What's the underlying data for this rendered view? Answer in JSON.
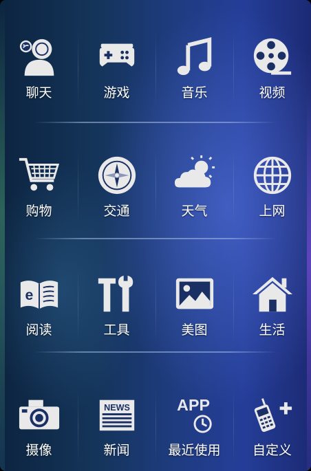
{
  "colors": {
    "icon": "#e9e9e9",
    "label": "#ffffff",
    "background_dark": "#0c2440",
    "background_light": "#243e98"
  },
  "rows": [
    {
      "items": [
        {
          "label": "聊天",
          "icon": "chat-person-icon"
        },
        {
          "label": "游戏",
          "icon": "gamepad-icon"
        },
        {
          "label": "音乐",
          "icon": "music-note-icon"
        },
        {
          "label": "视频",
          "icon": "film-reel-icon"
        }
      ]
    },
    {
      "items": [
        {
          "label": "购物",
          "icon": "shopping-cart-icon"
        },
        {
          "label": "交通",
          "icon": "compass-icon"
        },
        {
          "label": "天气",
          "icon": "weather-sun-cloud-icon"
        },
        {
          "label": "上网",
          "icon": "globe-icon"
        }
      ]
    },
    {
      "items": [
        {
          "label": "阅读",
          "icon": "open-book-icon"
        },
        {
          "label": "工具",
          "icon": "tools-icon"
        },
        {
          "label": "美图",
          "icon": "picture-icon"
        },
        {
          "label": "生活",
          "icon": "house-icon"
        }
      ]
    },
    {
      "items": [
        {
          "label": "摄像",
          "icon": "camera-icon"
        },
        {
          "label": "新闻",
          "icon": "newspaper-icon"
        },
        {
          "label": "最近使用",
          "icon": "app-recent-icon",
          "icon_text": "APP"
        },
        {
          "label": "自定义",
          "icon": "phone-add-icon"
        }
      ]
    }
  ],
  "newspaper_icon_text": "NEWS",
  "book_icon_letter": "e"
}
